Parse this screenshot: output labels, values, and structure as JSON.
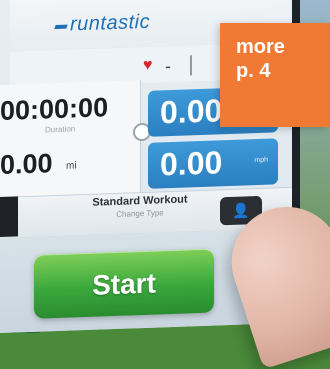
{
  "brand": {
    "name": "runtastic"
  },
  "status": {
    "heart_icon": "heart-icon",
    "separator": "-"
  },
  "stats": {
    "duration": "00:00:00",
    "duration_label": "Duration",
    "distance": "0.00",
    "distance_unit": "mi",
    "speed_current": "0.00",
    "speed_avg": "0.00",
    "speed_unit": "mph"
  },
  "workout": {
    "title": "Standard Workout",
    "subtitle": "Change Type"
  },
  "start": {
    "label": "Start"
  },
  "badge": {
    "line1": "more",
    "line2": "p. 4"
  },
  "colors": {
    "accent_orange": "#f07a34",
    "start_green": "#3aa83c",
    "speed_blue": "#2b7fc1"
  }
}
